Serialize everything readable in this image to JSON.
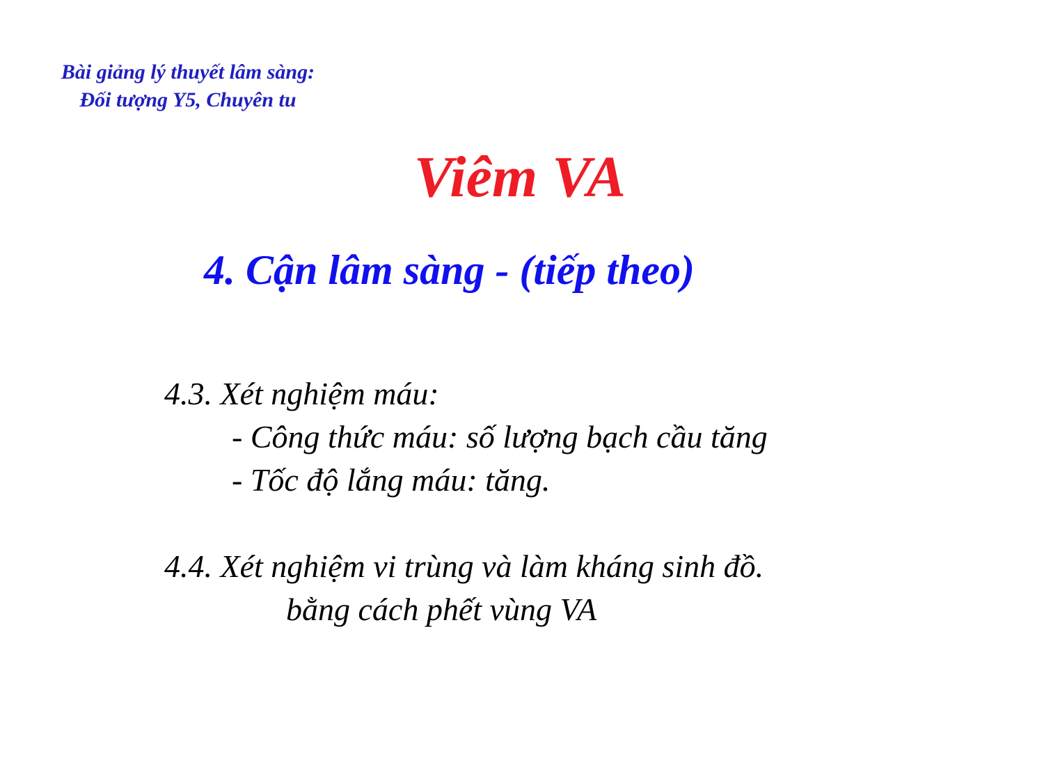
{
  "header": {
    "line1": "Bài giảng lý thuyết lâm sàng:",
    "line2": "Đối tượng Y5, Chuyên tu"
  },
  "title": "Viêm VA",
  "section_title": "4. Cận lâm sàng - (tiếp theo)",
  "content": {
    "blood_test": {
      "heading": "4.3. Xét nghiệm máu:",
      "items": [
        "- Công thức máu: số lượng bạch cầu tăng",
        "- Tốc độ lắng máu: tăng."
      ]
    },
    "microbe_test": {
      "heading": "4.4. Xét nghiệm vi trùng và làm kháng sinh đồ.",
      "detail": "bằng cách phết vùng VA"
    }
  },
  "colors": {
    "header": "#1f1fbf",
    "title": "#ee1c25",
    "section_title": "#1010ee",
    "body_text": "#000000",
    "background": "#ffffff"
  }
}
